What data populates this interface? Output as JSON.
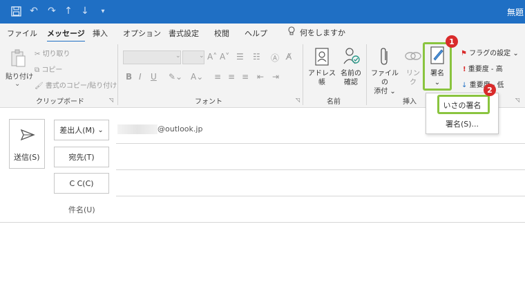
{
  "titlebar": {
    "title": "無題",
    "icons": [
      "save-icon",
      "undo-icon",
      "redo-icon",
      "up-icon",
      "down-icon",
      "customize-icon"
    ],
    "accent": "#1f6fc4"
  },
  "tabs": [
    "ファイル",
    "メッセージ",
    "挿入",
    "オプション",
    "書式設定",
    "校閲",
    "ヘルプ"
  ],
  "tell_me": "何をしますか",
  "ribbon": {
    "clipboard": {
      "paste": "貼り付け",
      "cut": "切り取り",
      "copy": "コピー",
      "format_painter": "書式のコピー/貼り付け",
      "label": "クリップボード"
    },
    "font": {
      "label": "フォント"
    },
    "names": {
      "address_book": "アドレス帳",
      "check_names_1": "名前の",
      "check_names_2": "確認",
      "label": "名前"
    },
    "insert": {
      "attach_1": "ファイルの",
      "attach_2": "添付",
      "link": "リンク",
      "signature": "署名",
      "label": "挿入"
    },
    "tags": {
      "flag": "フラグの設定",
      "high": "重要度 - 高",
      "low": "重要度 - 低"
    }
  },
  "dropdown": {
    "items": [
      "いさの署名",
      "署名(S)..."
    ]
  },
  "badges": [
    "1",
    "2"
  ],
  "compose": {
    "send": "送信(S)",
    "from_label": "差出人(M)",
    "from_value": "@outlook.jp",
    "to_label": "宛先(T)",
    "cc_label": "C C(C)",
    "subject_label": "件名(U)"
  },
  "colors": {
    "highlight": "#8ac43f",
    "badge": "#d92b2b"
  }
}
